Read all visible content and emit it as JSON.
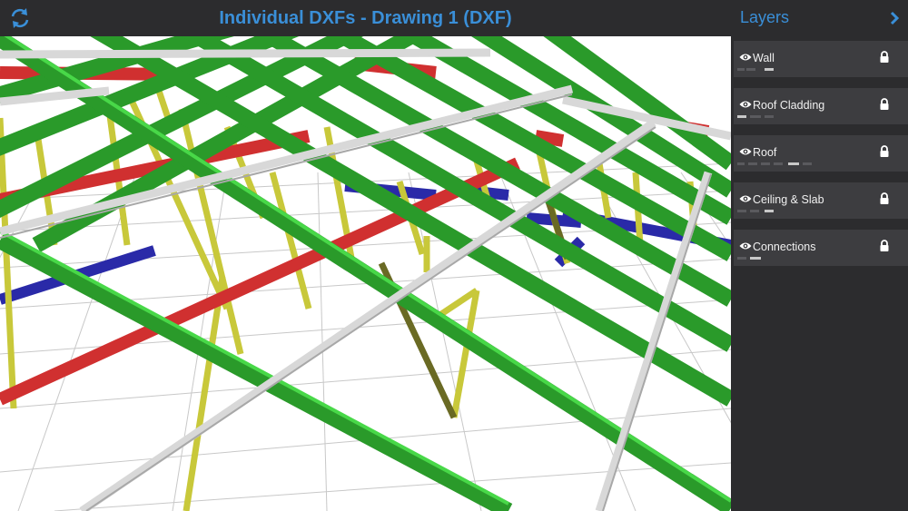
{
  "header": {
    "title": "Individual DXFs - Drawing 1 (DXF)",
    "refresh_icon": "refresh-icon"
  },
  "layers_panel": {
    "title": "Layers",
    "collapse_icon": "chevron-right-icon",
    "items": [
      {
        "label": "Wall",
        "visibility_icon": "eye-icon",
        "lock_icon": "lock-icon"
      },
      {
        "label": "Roof Cladding",
        "visibility_icon": "eye-icon",
        "lock_icon": "lock-icon"
      },
      {
        "label": "Roof",
        "visibility_icon": "eye-icon",
        "lock_icon": "lock-icon"
      },
      {
        "label": "Ceiling & Slab",
        "visibility_icon": "eye-icon",
        "lock_icon": "lock-icon"
      },
      {
        "label": "Connections",
        "visibility_icon": "eye-icon",
        "lock_icon": "lock-icon"
      }
    ]
  },
  "colors": {
    "accent": "#3a8fd8",
    "panel_bg": "#2c2c2e",
    "layer_bg": "#3d3d40",
    "rafter_green": "#2a9a2a",
    "batten_gray": "#d8d8d8",
    "beam_red": "#d03030",
    "joist_blue": "#2a2aa8",
    "post_yellow": "#c8c83a"
  }
}
